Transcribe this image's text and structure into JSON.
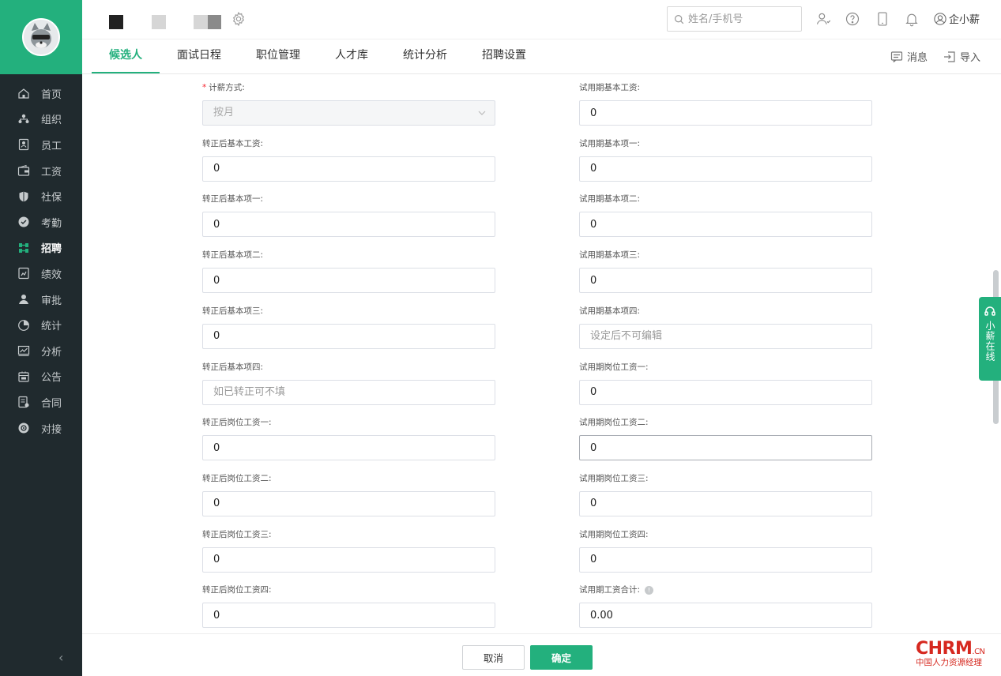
{
  "sidebar": {
    "items": [
      {
        "label": "首页",
        "icon": "home-icon"
      },
      {
        "label": "组织",
        "icon": "org-icon"
      },
      {
        "label": "员工",
        "icon": "employee-icon"
      },
      {
        "label": "工资",
        "icon": "wallet-icon"
      },
      {
        "label": "社保",
        "icon": "shield-icon"
      },
      {
        "label": "考勤",
        "icon": "location-icon"
      },
      {
        "label": "招聘",
        "icon": "recruit-icon",
        "active": true
      },
      {
        "label": "绩效",
        "icon": "performance-icon"
      },
      {
        "label": "审批",
        "icon": "approval-icon"
      },
      {
        "label": "统计",
        "icon": "pie-chart-icon"
      },
      {
        "label": "分析",
        "icon": "analysis-icon"
      },
      {
        "label": "公告",
        "icon": "announcement-icon"
      },
      {
        "label": "合同",
        "icon": "contract-icon"
      },
      {
        "label": "对接",
        "icon": "connect-icon"
      }
    ],
    "collapse_label": "‹"
  },
  "header": {
    "search_placeholder": "姓名/手机号",
    "user_name": "企小薪",
    "tabs": [
      {
        "label": "候选人",
        "active": true
      },
      {
        "label": "面试日程"
      },
      {
        "label": "职位管理"
      },
      {
        "label": "人才库"
      },
      {
        "label": "统计分析"
      },
      {
        "label": "招聘设置"
      }
    ],
    "actions": {
      "message": "消息",
      "import": "导入"
    }
  },
  "form": {
    "left": [
      {
        "label": "计薪方式:",
        "required": true,
        "value": "按月",
        "type": "select"
      },
      {
        "label": "转正后基本工资:",
        "value": "0"
      },
      {
        "label": "转正后基本项一:",
        "value": "0"
      },
      {
        "label": "转正后基本项二:",
        "value": "0"
      },
      {
        "label": "转正后基本项三:",
        "value": "0"
      },
      {
        "label": "转正后基本项四:",
        "value": "",
        "placeholder": "如已转正可不填"
      },
      {
        "label": "转正后岗位工资一:",
        "value": "0"
      },
      {
        "label": "转正后岗位工资二:",
        "value": "0"
      },
      {
        "label": "转正后岗位工资三:",
        "value": "0"
      },
      {
        "label": "转正后岗位工资四:",
        "value": "0"
      }
    ],
    "right": [
      {
        "label": "试用期基本工资:",
        "value": "0"
      },
      {
        "label": "试用期基本项一:",
        "value": "0"
      },
      {
        "label": "试用期基本项二:",
        "value": "0"
      },
      {
        "label": "试用期基本项三:",
        "value": "0"
      },
      {
        "label": "试用期基本项四:",
        "value": "",
        "placeholder": "设定后不可编辑"
      },
      {
        "label": "试用期岗位工资一:",
        "value": "0"
      },
      {
        "label": "试用期岗位工资二:",
        "value": "0",
        "focused": true
      },
      {
        "label": "试用期岗位工资三:",
        "value": "0"
      },
      {
        "label": "试用期岗位工资四:",
        "value": "0"
      },
      {
        "label": "试用期工资合计:",
        "value": "0.00",
        "info": "!"
      }
    ]
  },
  "chat": {
    "label": "小薪在线"
  },
  "footer": {
    "cancel": "取消",
    "confirm": "确定"
  },
  "watermark": {
    "main": "CHRM",
    "suffix": ".CN",
    "sub": "中国人力资源经理"
  },
  "colors": {
    "accent": "#23b07d",
    "sidebar_bg": "#202a2e",
    "required": "#f5222d"
  }
}
